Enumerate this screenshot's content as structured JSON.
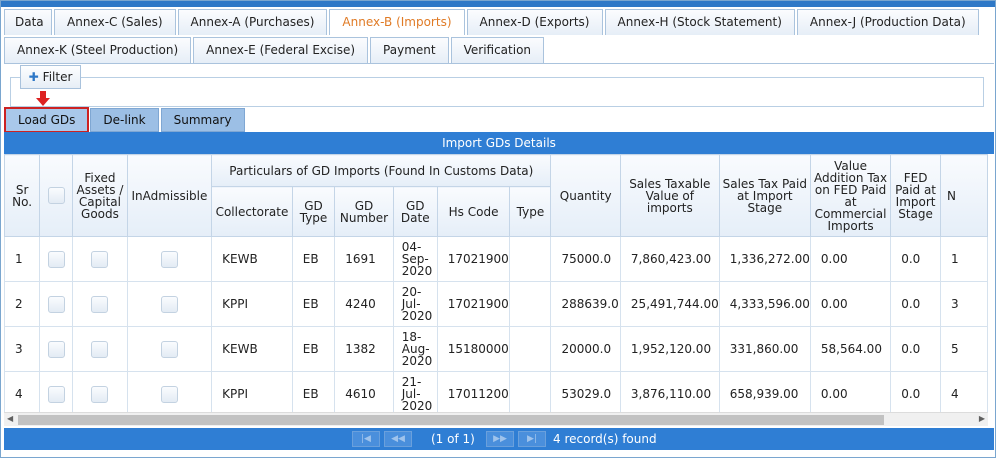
{
  "tabs_row1": [
    "Data",
    "Annex-C (Sales)",
    "Annex-A (Purchases)",
    "Annex-B (Imports)",
    "Annex-D (Exports)",
    "Annex-H (Stock Statement)",
    "Annex-J (Production Data)"
  ],
  "tabs_row2": [
    "Annex-K (Steel Production)",
    "Annex-E (Federal Excise)",
    "Payment",
    "Verification"
  ],
  "filter": {
    "label": "Filter"
  },
  "subtabs": {
    "load": "Load GDs",
    "delink": "De-link",
    "summary": "Summary"
  },
  "grid": {
    "title": "Import GDs Details",
    "headers": {
      "sr": "Sr No.",
      "fixed_assets": "Fixed Assets / Capital Goods",
      "inadmissible": "InAdmissible",
      "group": "Particulars of GD Imports (Found In Customs Data)",
      "collectorate": "Collectorate",
      "gd_type": "GD Type",
      "gd_number": "GD Number",
      "gd_date": "GD Date",
      "hs_code": "Hs Code",
      "type": "Type",
      "quantity": "Quantity",
      "sales_taxable": "Sales Taxable Value of imports",
      "sales_tax": "Sales Tax Paid at Import Stage",
      "vat": "Value Addition Tax on FED Paid at Commercial Imports",
      "fed": "FED Paid at Import Stage",
      "last": "N"
    },
    "rows": [
      {
        "sr": "1",
        "collectorate": "KEWB",
        "gd_type": "EB",
        "gd_number": "1691",
        "gd_date": "04-Sep-2020",
        "hs_code": "17021900",
        "type": "",
        "quantity": "75000.0",
        "sales_taxable": "7,860,423.00",
        "sales_tax": "1,336,272.00",
        "vat": "0.00",
        "fed": "0.0",
        "last": "1"
      },
      {
        "sr": "2",
        "collectorate": "KPPI",
        "gd_type": "EB",
        "gd_number": "4240",
        "gd_date": "20-Jul-2020",
        "hs_code": "17021900",
        "type": "",
        "quantity": "288639.0",
        "sales_taxable": "25,491,744.00",
        "sales_tax": "4,333,596.00",
        "vat": "0.00",
        "fed": "0.0",
        "last": "3"
      },
      {
        "sr": "3",
        "collectorate": "KEWB",
        "gd_type": "EB",
        "gd_number": "1382",
        "gd_date": "18-Aug-2020",
        "hs_code": "15180000",
        "type": "",
        "quantity": "20000.0",
        "sales_taxable": "1,952,120.00",
        "sales_tax": "331,860.00",
        "vat": "58,564.00",
        "fed": "0.0",
        "last": "5"
      },
      {
        "sr": "4",
        "collectorate": "KPPI",
        "gd_type": "EB",
        "gd_number": "4610",
        "gd_date": "21-Jul-2020",
        "hs_code": "17011200",
        "type": "",
        "quantity": "53029.0",
        "sales_taxable": "3,876,110.00",
        "sales_tax": "658,939.00",
        "vat": "0.00",
        "fed": "0.0",
        "last": "4"
      }
    ]
  },
  "paginator": {
    "first": "|◀",
    "prev": "◀◀",
    "next": "▶▶",
    "last": "▶|",
    "page_info": "(1 of 1)",
    "records": "4 record(s) found"
  },
  "colors": {
    "header_blue": "#2f7ed4",
    "active_tab": "#e07b26",
    "highlight_red": "#cc2222"
  }
}
